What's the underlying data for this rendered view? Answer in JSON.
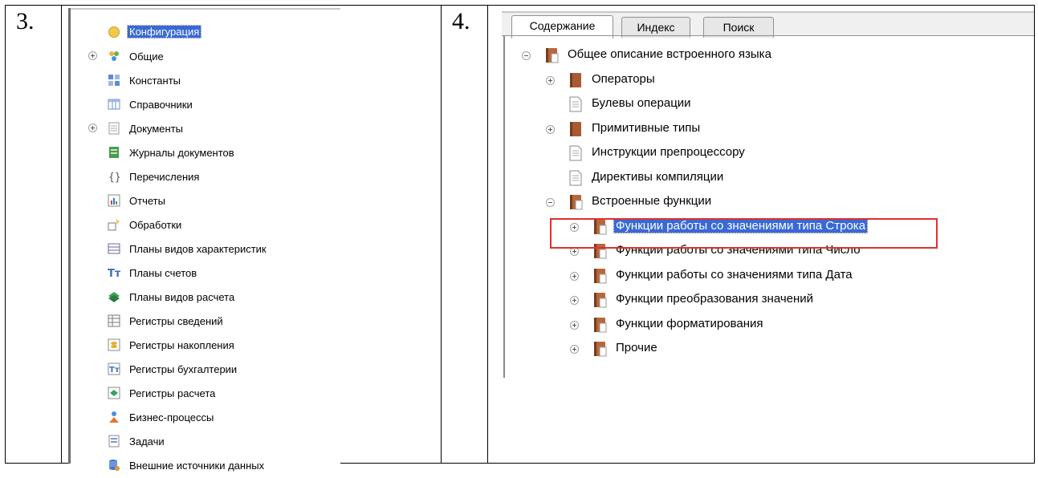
{
  "numbers": {
    "three": "3.",
    "four": "4."
  },
  "config_tree": {
    "items": [
      {
        "label": "Конфигурация",
        "icon": "config-root-icon",
        "expand": "",
        "selected": true
      },
      {
        "label": "Общие",
        "icon": "common-icon",
        "expand": "plus"
      },
      {
        "label": "Константы",
        "icon": "constants-icon",
        "expand": ""
      },
      {
        "label": "Справочники",
        "icon": "catalogs-icon",
        "expand": ""
      },
      {
        "label": "Документы",
        "icon": "documents-icon",
        "expand": "plus"
      },
      {
        "label": "Журналы документов",
        "icon": "document-journals-icon",
        "expand": ""
      },
      {
        "label": "Перечисления",
        "icon": "enums-icon",
        "expand": ""
      },
      {
        "label": "Отчеты",
        "icon": "reports-icon",
        "expand": ""
      },
      {
        "label": "Обработки",
        "icon": "data-processors-icon",
        "expand": ""
      },
      {
        "label": "Планы видов характеристик",
        "icon": "chart-of-characteristic-types-icon",
        "expand": ""
      },
      {
        "label": "Планы счетов",
        "icon": "chart-of-accounts-icon",
        "expand": ""
      },
      {
        "label": "Планы видов расчета",
        "icon": "chart-of-calculation-types-icon",
        "expand": ""
      },
      {
        "label": "Регистры сведений",
        "icon": "information-registers-icon",
        "expand": ""
      },
      {
        "label": "Регистры накопления",
        "icon": "accumulation-registers-icon",
        "expand": ""
      },
      {
        "label": "Регистры бухгалтерии",
        "icon": "accounting-registers-icon",
        "expand": ""
      },
      {
        "label": "Регистры расчета",
        "icon": "calculation-registers-icon",
        "expand": ""
      },
      {
        "label": "Бизнес-процессы",
        "icon": "business-processes-icon",
        "expand": ""
      },
      {
        "label": "Задачи",
        "icon": "tasks-icon",
        "expand": ""
      },
      {
        "label": "Внешние источники данных",
        "icon": "external-data-sources-icon",
        "expand": ""
      }
    ]
  },
  "help_panel": {
    "tabs": [
      {
        "label": "Содержание",
        "active": true
      },
      {
        "label": "Индекс"
      },
      {
        "label": "Поиск"
      }
    ],
    "items": [
      {
        "label": "Общее описание встроенного языка",
        "level": 0,
        "expand": "minus",
        "icon": "open-book-icon"
      },
      {
        "label": "Операторы",
        "level": 1,
        "expand": "plus",
        "icon": "book-icon"
      },
      {
        "label": "Булевы операции",
        "level": 1,
        "expand": "",
        "icon": "page-icon"
      },
      {
        "label": "Примитивные типы",
        "level": 1,
        "expand": "plus",
        "icon": "book-icon"
      },
      {
        "label": "Инструкции препроцессору",
        "level": 1,
        "expand": "",
        "icon": "page-icon"
      },
      {
        "label": "Директивы компиляции",
        "level": 1,
        "expand": "",
        "icon": "page-icon"
      },
      {
        "label": "Встроенные функции",
        "level": 1,
        "expand": "minus",
        "icon": "open-book-icon"
      },
      {
        "label": "Функции работы со значениями типа Строка",
        "level": 2,
        "expand": "plus",
        "icon": "open-book-icon",
        "selected": true
      },
      {
        "label": "Функции работы со значениями типа Число",
        "level": 2,
        "expand": "plus",
        "icon": "open-book-icon"
      },
      {
        "label": "Функции работы со значениями типа Дата",
        "level": 2,
        "expand": "plus",
        "icon": "open-book-icon"
      },
      {
        "label": "Функции преобразования значений",
        "level": 2,
        "expand": "plus",
        "icon": "open-book-icon"
      },
      {
        "label": "Функции форматирования",
        "level": 2,
        "expand": "plus",
        "icon": "open-book-icon"
      },
      {
        "label": "Прочие",
        "level": 2,
        "expand": "plus",
        "icon": "open-book-icon"
      }
    ]
  },
  "colors": {
    "selection": "#3969d5",
    "highlight_box": "#e0302f",
    "book": "#b8663c"
  }
}
